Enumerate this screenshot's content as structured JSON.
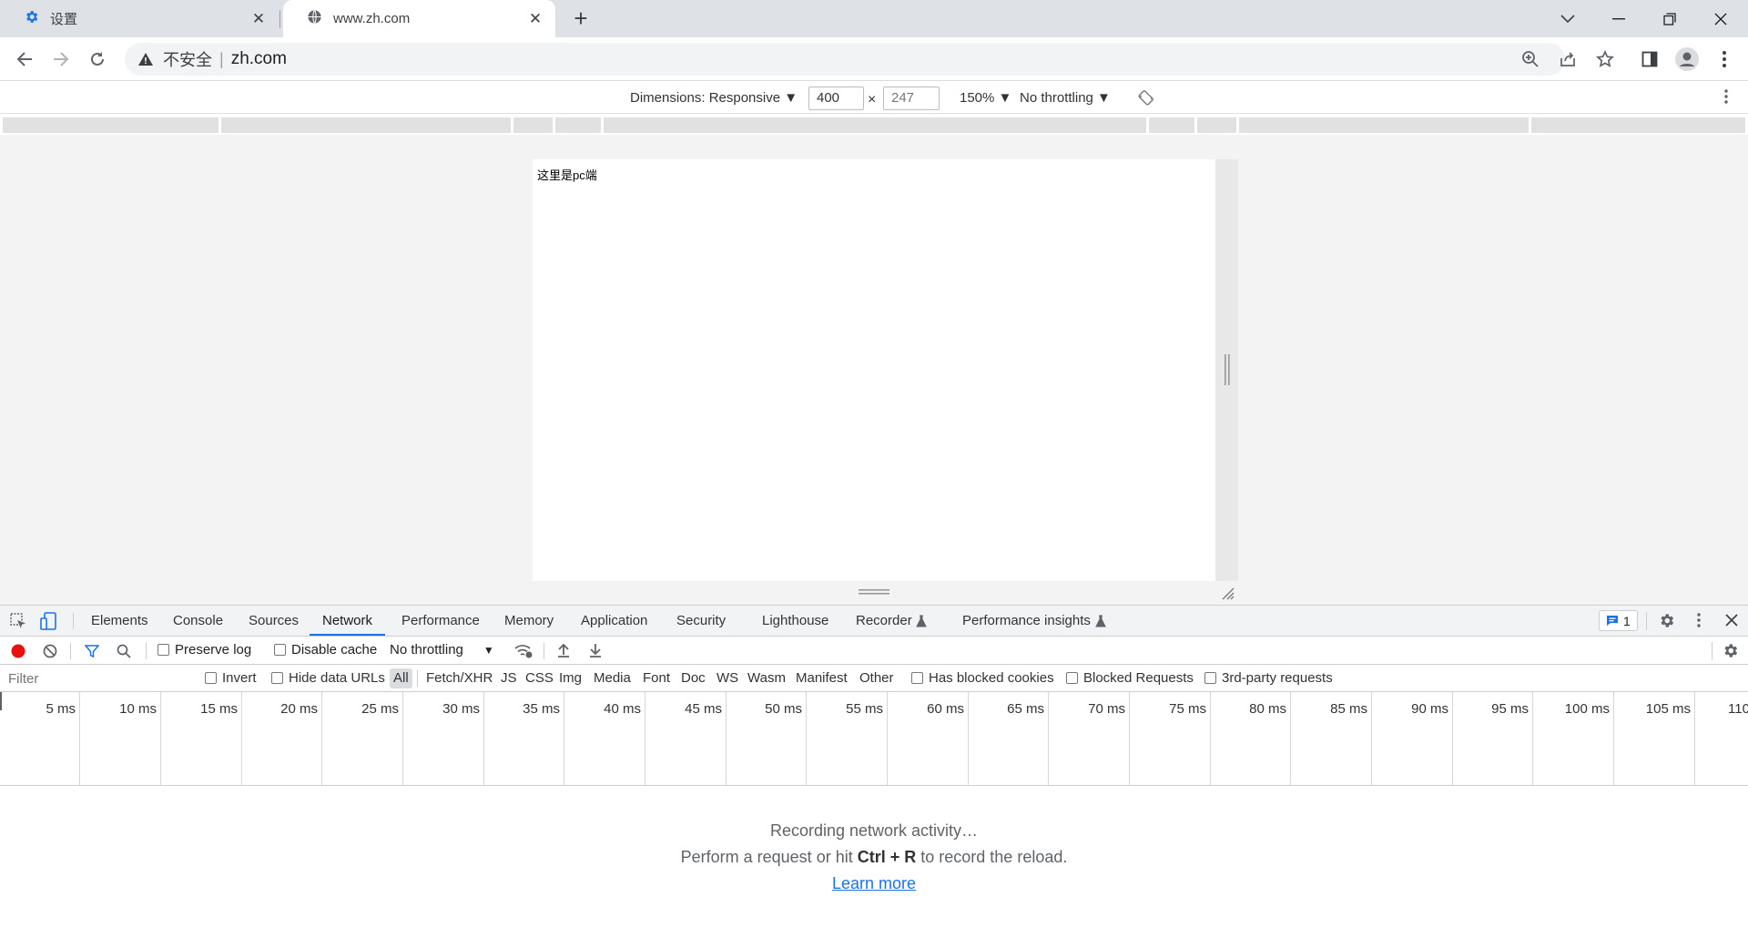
{
  "tabs": [
    {
      "title": "设置",
      "icon": "gear-icon"
    },
    {
      "title": "www.zh.com",
      "icon": "globe-icon"
    }
  ],
  "omnibox": {
    "security_label": "不安全",
    "url": "zh.com"
  },
  "device_toolbar": {
    "dimensions_label": "Dimensions: Responsive ▼",
    "width": "400",
    "times": "×",
    "height": "247",
    "zoom": "150% ▼",
    "throttling": "No throttling ▼"
  },
  "page": {
    "text": "这里是pc端"
  },
  "devtools": {
    "tabs": [
      "Elements",
      "Console",
      "Sources",
      "Network",
      "Performance",
      "Memory",
      "Application",
      "Security",
      "Lighthouse",
      "Recorder",
      "Performance insights"
    ],
    "active_tab": "Network",
    "issues_count": "1",
    "network": {
      "preserve_log": "Preserve log",
      "disable_cache": "Disable cache",
      "throttling": "No throttling",
      "filter_placeholder": "Filter",
      "invert": "Invert",
      "hide_data_urls": "Hide data URLs",
      "types": [
        "All",
        "Fetch/XHR",
        "JS",
        "CSS",
        "Img",
        "Media",
        "Font",
        "Doc",
        "WS",
        "Wasm",
        "Manifest",
        "Other"
      ],
      "has_blocked_cookies": "Has blocked cookies",
      "blocked_requests": "Blocked Requests",
      "third_party": "3rd-party requests",
      "ticks": [
        "5 ms",
        "10 ms",
        "15 ms",
        "20 ms",
        "25 ms",
        "30 ms",
        "35 ms",
        "40 ms",
        "45 ms",
        "50 ms",
        "55 ms",
        "60 ms",
        "65 ms",
        "70 ms",
        "75 ms",
        "80 ms",
        "85 ms",
        "90 ms",
        "95 ms",
        "100 ms",
        "105 ms",
        "110"
      ],
      "empty_line1": "Recording network activity…",
      "empty_line2_pre": "Perform a request or hit",
      "empty_line2_key": "Ctrl + R",
      "empty_line2_post": "to record the reload.",
      "learn_more": "Learn more"
    }
  }
}
